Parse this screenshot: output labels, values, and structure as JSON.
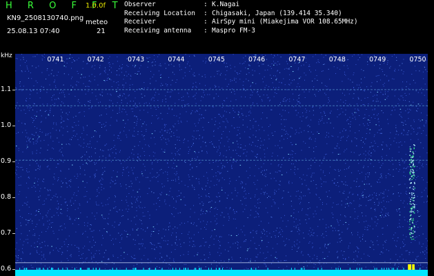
{
  "header": {
    "app_title": "H R O F F T",
    "version": "1.0.0f",
    "filename": "KN9_2508130740.png",
    "meteo_label": "meteo",
    "datetime": "25.08.13 07:40",
    "count": "21"
  },
  "info": [
    {
      "label": "Observer",
      "value": "K.Nagai"
    },
    {
      "label": "Receiving Location",
      "value": "Chigasaki, Japan (139.414 35.340)"
    },
    {
      "label": "Receiver",
      "value": "AirSpy mini (Miakejima VOR 108.65MHz)"
    },
    {
      "label": "Receiving antenna",
      "value": "Maspro FM-3"
    }
  ],
  "axis": {
    "unit": "kHz",
    "y_labels": [
      "1.1",
      "1.0",
      "0.9",
      "0.8",
      "0.7",
      "0.6"
    ],
    "y_values": [
      1.1,
      1.0,
      0.9,
      0.8,
      0.7,
      0.6
    ],
    "y_range": [
      0.58,
      1.2
    ],
    "time_labels": [
      "0741",
      "0742",
      "0743",
      "0744",
      "0745",
      "0746",
      "0747",
      "0748",
      "0749",
      "0750"
    ],
    "time_minutes": [
      41,
      42,
      43,
      44,
      45,
      46,
      47,
      48,
      49,
      50
    ],
    "time_range": [
      40,
      50.25
    ]
  },
  "colors": {
    "background": "#000000",
    "spectrogram_base": "#0c1f7a",
    "noise_light": "#3a5bd8",
    "noise_bright": "#7fd6ff",
    "signal": "#b9f7ff",
    "baseline_bar": "#00e5ff",
    "title": "#39ff39",
    "version": "#e8e800"
  }
}
